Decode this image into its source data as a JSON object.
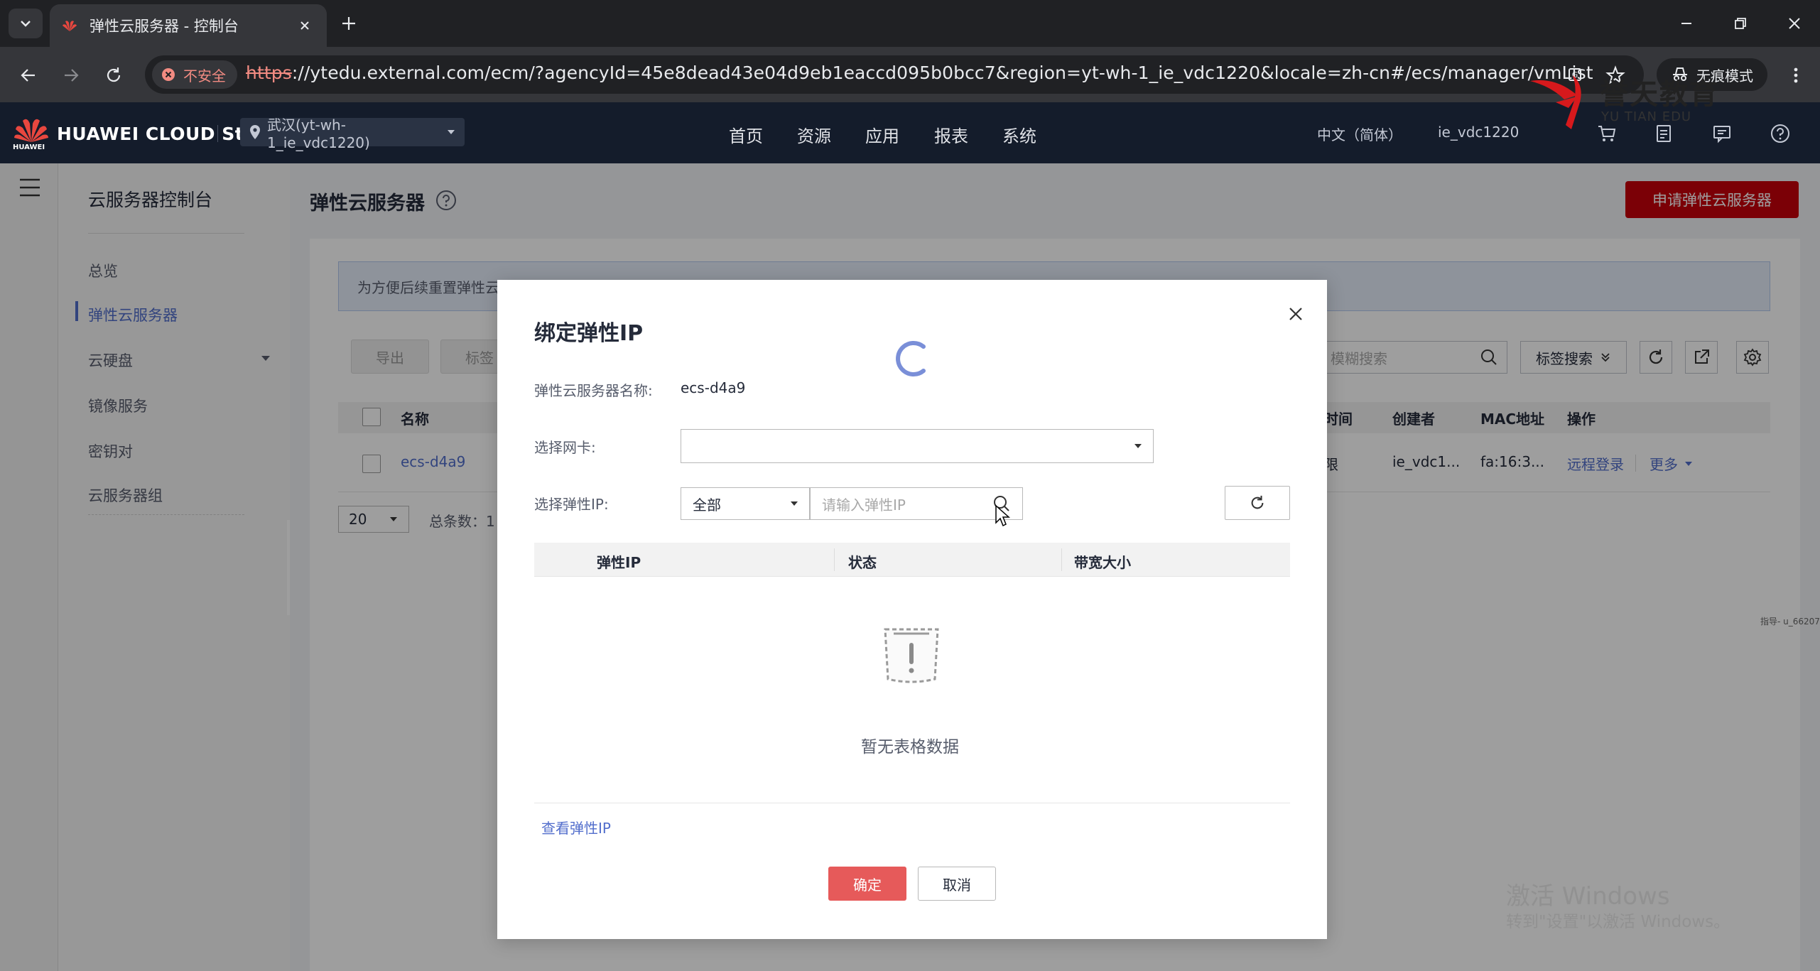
{
  "browser": {
    "tab_title": "弹性云服务器 - 控制台",
    "security_label": "不安全",
    "url_protocol": "https",
    "url_rest": "://ytedu.external.com/ecm/?agencyId=45e8dead43e04d9eb1eaccd095b0bcc7&region=yt-wh-1_ie_vdc1220&locale=zh-cn#/ecs/manager/vmList",
    "incognito_label": "无痕模式"
  },
  "watermark": {
    "brand_cn": "誉天教育",
    "brand_en": "YU TIAN EDU"
  },
  "header": {
    "logo_text": "HUAWEI CLOUD Stack",
    "logo_sub": "HUAWEI",
    "region": "武汉(yt-wh-1_ie_vdc1220)",
    "nav": [
      "首页",
      "资源",
      "应用",
      "报表",
      "系统"
    ],
    "language": "中文（简体）",
    "user": "ie_vdc1220"
  },
  "sidebar": {
    "title": "云服务器控制台",
    "items": [
      {
        "label": "总览"
      },
      {
        "label": "弹性云服务器"
      },
      {
        "label": "云硬盘"
      },
      {
        "label": "镜像服务"
      },
      {
        "label": "密钥对"
      },
      {
        "label": "云服务器组"
      }
    ]
  },
  "main": {
    "title": "弹性云服务器",
    "apply_button": "申请弹性云服务器",
    "notice": "为方便后续重置弹性云",
    "buttons": {
      "export": "导出",
      "tag": "标签"
    },
    "search_placeholder": "模糊搜索",
    "tag_search": "标签搜索",
    "columns": [
      "名称",
      "时间",
      "创建者",
      "MAC地址",
      "操作"
    ],
    "row": {
      "name": "ecs-d4a9",
      "time": "限",
      "creator": "ie_vdc1...",
      "mac": "fa:16:3...",
      "remote_login": "远程登录",
      "more": "更多"
    },
    "page_size": "20",
    "total": "总条数：1",
    "tiny_note": "指导- u_66207"
  },
  "modal": {
    "title": "绑定弹性IP",
    "server_name_label": "弹性云服务器名称:",
    "server_name": "ecs-d4a9",
    "nic_label": "选择网卡:",
    "eip_label": "选择弹性IP:",
    "filter_value": "全部",
    "ip_placeholder": "请输入弹性IP",
    "columns": [
      "弹性IP",
      "状态",
      "带宽大小"
    ],
    "empty_text": "暂无表格数据",
    "view_link": "查看弹性IP",
    "ok": "确定",
    "cancel": "取消"
  },
  "os_watermark": {
    "line1": "激活 Windows",
    "line2": "转到\"设置\"以激活 Windows。"
  },
  "colors": {
    "brand_red": "#c7000b",
    "link_blue": "#526ecc",
    "ok_button": "#e65a5a",
    "header_bg": "#141c2b"
  }
}
